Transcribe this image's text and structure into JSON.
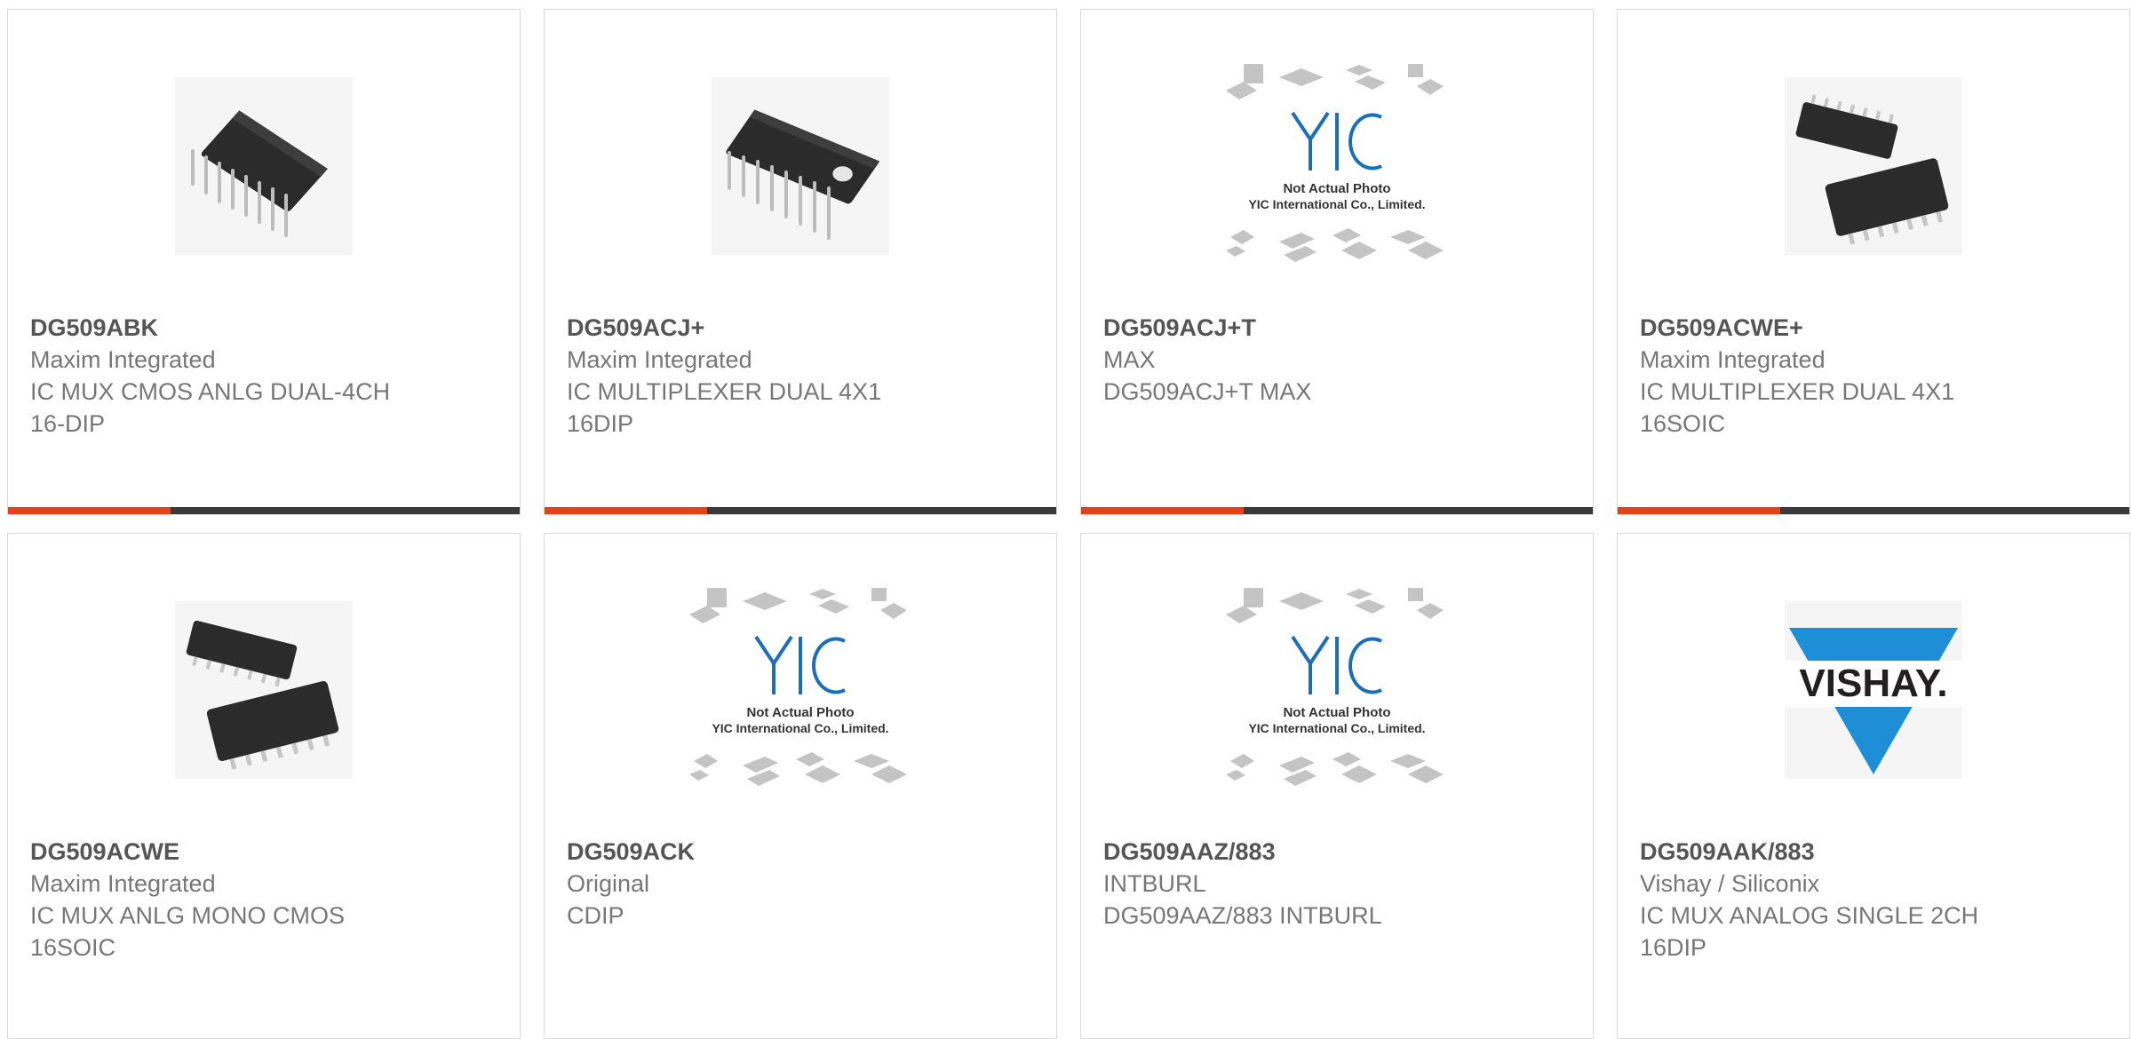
{
  "products": [
    {
      "part": "DG509ABK",
      "maker": "Maxim Integrated",
      "desc": "IC MUX CMOS ANLG DUAL-4CH\n16-DIP",
      "image": "dip-ic-image"
    },
    {
      "part": "DG509ACJ+",
      "maker": "Maxim Integrated",
      "desc": "IC MULTIPLEXER DUAL 4X1\n16DIP",
      "image": "dip-ic-image"
    },
    {
      "part": "DG509ACJ+T",
      "maker": "MAX",
      "desc": "DG509ACJ+T MAX",
      "image": "placeholder-yic-image",
      "placeholder_line1": "Not Actual Photo",
      "placeholder_line2": "YIC International Co., Limited."
    },
    {
      "part": "DG509ACWE+",
      "maker": "Maxim Integrated",
      "desc": "IC MULTIPLEXER DUAL 4X1\n16SOIC",
      "image": "soic-ic-image"
    },
    {
      "part": "DG509ACWE",
      "maker": "Maxim Integrated",
      "desc": "IC MUX ANLG MONO CMOS\n16SOIC",
      "image": "soic-ic-image"
    },
    {
      "part": "DG509ACK",
      "maker": "Original",
      "desc": "CDIP",
      "image": "placeholder-yic-image",
      "placeholder_line1": "Not Actual Photo",
      "placeholder_line2": "YIC International Co., Limited."
    },
    {
      "part": "DG509AAZ/883",
      "maker": "INTBURL",
      "desc": "DG509AAZ/883 INTBURL",
      "image": "placeholder-yic-image",
      "placeholder_line1": "Not Actual Photo",
      "placeholder_line2": "YIC International Co., Limited."
    },
    {
      "part": "DG509AAK/883",
      "maker": "Vishay / Siliconix",
      "desc": "IC MUX ANALOG SINGLE 2CH\n16DIP",
      "image": "vishay-logo-image",
      "logo_text": "VISHAY."
    }
  ],
  "colors": {
    "accent": "#e8401c",
    "bar": "#3a3a3a",
    "vishay_blue": "#1e8fd6",
    "yic_blue": "#1b6fb8"
  }
}
